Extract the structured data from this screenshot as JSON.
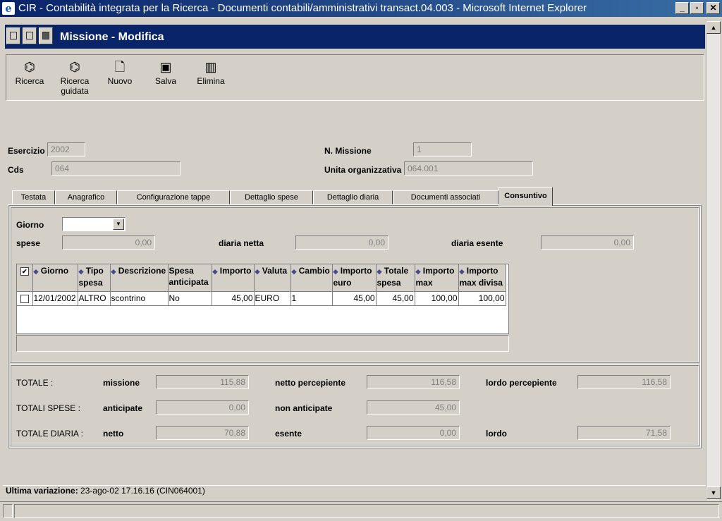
{
  "window": {
    "title": "CIR - Contabilità integrata per la Ricerca - Documenti contabili/amministrativi transact.04.003 - Microsoft Internet Explorer",
    "minimize": "_",
    "restore": "▫",
    "close": "✕"
  },
  "form": {
    "title": "Missione - Modifica"
  },
  "toolbar": [
    {
      "label": "Ricerca",
      "icon": "binoculars-icon"
    },
    {
      "label": "Ricerca guidata",
      "icon": "binoculars-arrow-icon"
    },
    {
      "label": "Nuovo",
      "icon": "new-document-icon"
    },
    {
      "label": "Salva",
      "icon": "floppy-disk-icon"
    },
    {
      "label": "Elimina",
      "icon": "trash-icon"
    }
  ],
  "header": {
    "esercizio_label": "Esercizio",
    "esercizio_value": "2002",
    "cds_label": "Cds",
    "cds_value": "064",
    "n_missione_label": "N. Missione",
    "n_missione_value": "1",
    "unita_label": "Unita organizzativa",
    "unita_value": "064.001"
  },
  "tabs": [
    "Testata",
    "Anagrafico",
    "Configurazione tappe",
    "Dettaglio spese",
    "Dettaglio diaria",
    "Documenti associati",
    "Consuntivo"
  ],
  "active_tab": "Consuntivo",
  "consuntivo": {
    "giorno_label": "Giorno",
    "giorno_value": "",
    "spese_label": "spese",
    "spese_value": "0,00",
    "diaria_netta_label": "diaria netta",
    "diaria_netta_value": "0,00",
    "diaria_esente_label": "diaria esente",
    "diaria_esente_value": "0,00"
  },
  "grid": {
    "columns": [
      "Giorno",
      "Tipo spesa",
      "Descrizione",
      "Spesa anticipata",
      "Importo",
      "Valuta",
      "Cambio",
      "Importo euro",
      "Totale spesa",
      "Importo max",
      "Importo max divisa"
    ],
    "rows": [
      [
        "12/01/2002",
        "ALTRO",
        "scontrino",
        "No",
        "45,00",
        "EURO",
        "1",
        "45,00",
        "45,00",
        "100,00",
        "100,00"
      ]
    ]
  },
  "totals": {
    "totale_label": "TOTALE :",
    "missione_label": "missione",
    "missione_value": "115,88",
    "netto_percepiente_label": "netto percepiente",
    "netto_percepiente_value": "116,58",
    "lordo_percepiente_label": "lordo percepiente",
    "lordo_percepiente_value": "116,58",
    "totali_spese_label": "TOTALI SPESE :",
    "anticipate_label": "anticipate",
    "anticipate_value": "0,00",
    "non_anticipate_label": "non anticipate",
    "non_anticipate_value": "45,00",
    "totale_diaria_label": "TOTALE DIARIA :",
    "netto_label": "netto",
    "netto_value": "70,88",
    "esente_label": "esente",
    "esente_value": "0,00",
    "lordo_label": "lordo",
    "lordo_value": "71,58"
  },
  "status": {
    "label": "Ultima variazione:",
    "value": "23-ago-02 17.16.16 (CIN064001)"
  }
}
